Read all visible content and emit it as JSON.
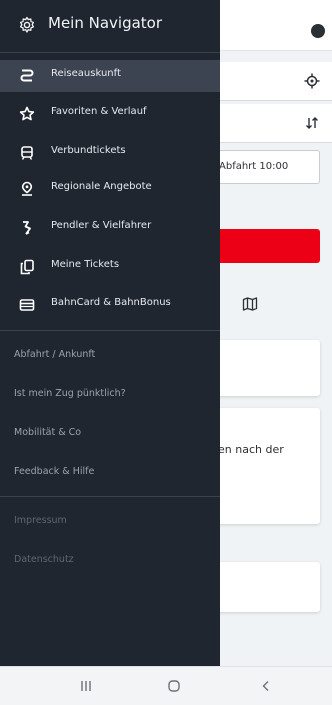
{
  "drawer": {
    "title": "Mein Navigator",
    "items": [
      {
        "label": "Reiseauskunft",
        "icon": "route-icon",
        "active": true
      },
      {
        "label": "Favoriten & Verlauf",
        "icon": "star-icon",
        "active": false
      },
      {
        "label": "Verbundtickets",
        "icon": "tram-icon",
        "active": false
      },
      {
        "label": "Regionale Angebote",
        "icon": "location-pin-icon",
        "active": false
      },
      {
        "label": "Pendler & Vielfahrer",
        "icon": "commuter-icon",
        "active": false
      },
      {
        "label": "Meine Tickets",
        "icon": "tickets-icon",
        "active": false
      },
      {
        "label": "BahnCard & BahnBonus",
        "icon": "card-icon",
        "active": false
      }
    ],
    "links": [
      "Abfahrt / Ankunft",
      "Ist mein Zug pünktlich?",
      "Mobilität & Co",
      "Feedback & Hilfe"
    ],
    "legal": [
      "Impressum",
      "Datenschutz"
    ]
  },
  "background": {
    "time_label": "Abfahrt 10:00",
    "card_text": "en nach der"
  },
  "colors": {
    "drawer_bg": "#1f2630",
    "active_bg": "#3b4450",
    "accent_red": "#ec0016"
  }
}
